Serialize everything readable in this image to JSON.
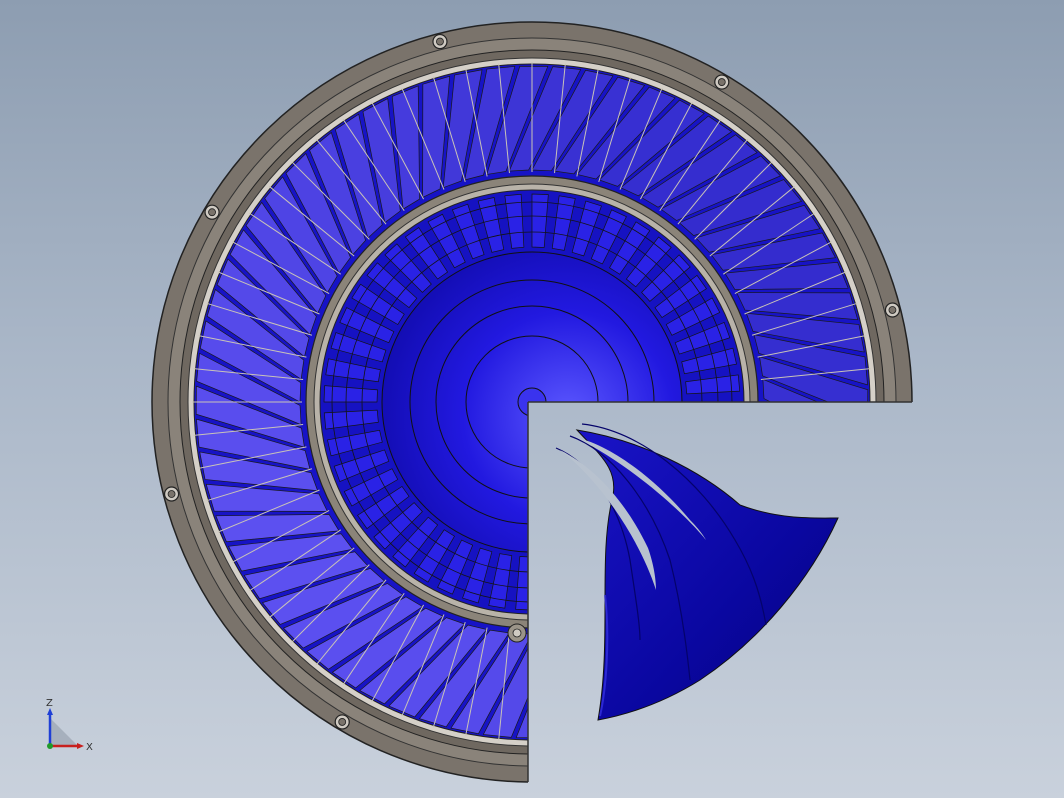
{
  "viewport": {
    "background_top": "#8d9db1",
    "background_bottom": "#c9d1dc"
  },
  "model": {
    "part_color": "#1a12d8",
    "part_highlight": "#6f6bff",
    "casing_color": "#7d756d",
    "edge_color": "#222222",
    "outer_blade_count": 64,
    "inner_vane_count": 48,
    "mount_hole_count": 8,
    "cutaway": "quarter-section",
    "detached_blade_count": 3
  },
  "triad": {
    "z_label": "Z",
    "x_label": "X",
    "z_color": "#1f3fd6",
    "x_color": "#c8201e",
    "y_color": "#1f9a2a"
  }
}
